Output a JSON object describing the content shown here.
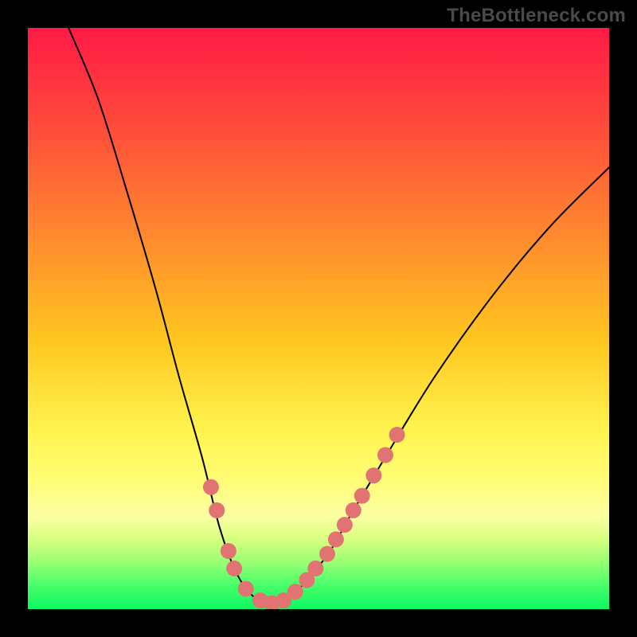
{
  "watermark": "TheBottleneck.com",
  "chart_data": {
    "type": "line",
    "title": "",
    "xlabel": "",
    "ylabel": "",
    "xlim": [
      0,
      100
    ],
    "ylim": [
      0,
      100
    ],
    "grid": false,
    "legend": false,
    "curve": {
      "name": "bottleneck-curve",
      "color": "#000000",
      "points": [
        {
          "x": 7,
          "y": 100
        },
        {
          "x": 12,
          "y": 88
        },
        {
          "x": 17,
          "y": 72
        },
        {
          "x": 22,
          "y": 55
        },
        {
          "x": 26,
          "y": 40
        },
        {
          "x": 30,
          "y": 26
        },
        {
          "x": 33,
          "y": 14
        },
        {
          "x": 36,
          "y": 6
        },
        {
          "x": 39,
          "y": 2
        },
        {
          "x": 42,
          "y": 1
        },
        {
          "x": 45,
          "y": 2
        },
        {
          "x": 48,
          "y": 5
        },
        {
          "x": 52,
          "y": 10
        },
        {
          "x": 56,
          "y": 17
        },
        {
          "x": 62,
          "y": 27
        },
        {
          "x": 70,
          "y": 40
        },
        {
          "x": 80,
          "y": 54
        },
        {
          "x": 90,
          "y": 66
        },
        {
          "x": 100,
          "y": 76
        }
      ]
    },
    "markers": {
      "name": "data-markers",
      "color": "#e17373",
      "radius": 10,
      "points": [
        {
          "x": 31.5,
          "y": 21
        },
        {
          "x": 32.5,
          "y": 17
        },
        {
          "x": 34.5,
          "y": 10
        },
        {
          "x": 35.5,
          "y": 7
        },
        {
          "x": 37.5,
          "y": 3.5
        },
        {
          "x": 40,
          "y": 1.5
        },
        {
          "x": 42,
          "y": 1
        },
        {
          "x": 44,
          "y": 1.5
        },
        {
          "x": 46,
          "y": 3
        },
        {
          "x": 48,
          "y": 5
        },
        {
          "x": 49.5,
          "y": 7
        },
        {
          "x": 51.5,
          "y": 9.5
        },
        {
          "x": 53,
          "y": 12
        },
        {
          "x": 54.5,
          "y": 14.5
        },
        {
          "x": 56,
          "y": 17
        },
        {
          "x": 57.5,
          "y": 19.5
        },
        {
          "x": 59.5,
          "y": 23
        },
        {
          "x": 61.5,
          "y": 26.5
        },
        {
          "x": 63.5,
          "y": 30
        }
      ]
    }
  }
}
